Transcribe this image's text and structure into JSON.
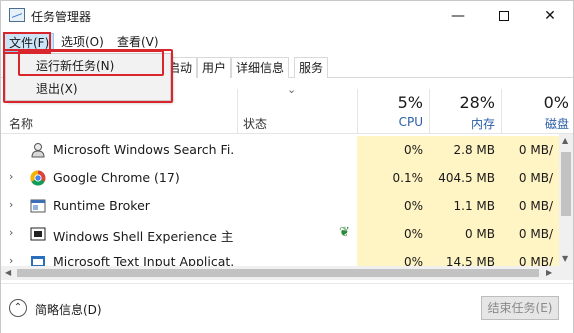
{
  "window": {
    "title": "任务管理器",
    "minimize_glyph": "—",
    "close_glyph": "✕"
  },
  "menubar": {
    "file": "文件(F)",
    "options": "选项(O)",
    "view": "查看(V)"
  },
  "file_menu": {
    "items": [
      "运行新任务(N)",
      "退出(X)"
    ]
  },
  "tabs": [
    "启动",
    "用户",
    "详细信息",
    "服务"
  ],
  "header": {
    "name": "名称",
    "status": "状态",
    "cpu": {
      "pct": "5%",
      "label": "CPU"
    },
    "memory": {
      "pct": "28%",
      "label": "内存"
    },
    "disk": {
      "pct": "0%",
      "label": "磁盘"
    }
  },
  "processes": [
    {
      "name": "Microsoft Windows Search Fi...",
      "icon": "search-indexer-icon",
      "expandable": false,
      "cpu": "0%",
      "memory": "2.8 MB",
      "disk": "0 MB/"
    },
    {
      "name": "Google Chrome (17)",
      "icon": "chrome-icon",
      "expandable": true,
      "cpu": "0.1%",
      "memory": "404.5 MB",
      "disk": "0 MB/"
    },
    {
      "name": "Runtime Broker",
      "icon": "runtime-broker-icon",
      "expandable": true,
      "cpu": "0%",
      "memory": "1.1 MB",
      "disk": "0 MB/"
    },
    {
      "name": "Windows Shell Experience 主...",
      "icon": "shell-experience-icon",
      "expandable": true,
      "cpu": "0%",
      "memory": "0 MB",
      "disk": "0 MB/",
      "suspended_leaf": true
    },
    {
      "name": "Microsoft Text Input Applicat...",
      "icon": "text-input-icon",
      "expandable": true,
      "cpu": "0%",
      "memory": "14.5 MB",
      "disk": "0 MB/"
    }
  ],
  "footer": {
    "fewer_details": "简略信息(D)",
    "end_task": "结束任务(E)"
  },
  "colors": {
    "highlight_fill": "#fff4c4",
    "outline_red": "#d9262c",
    "column_blue": "#2a5ea8"
  }
}
